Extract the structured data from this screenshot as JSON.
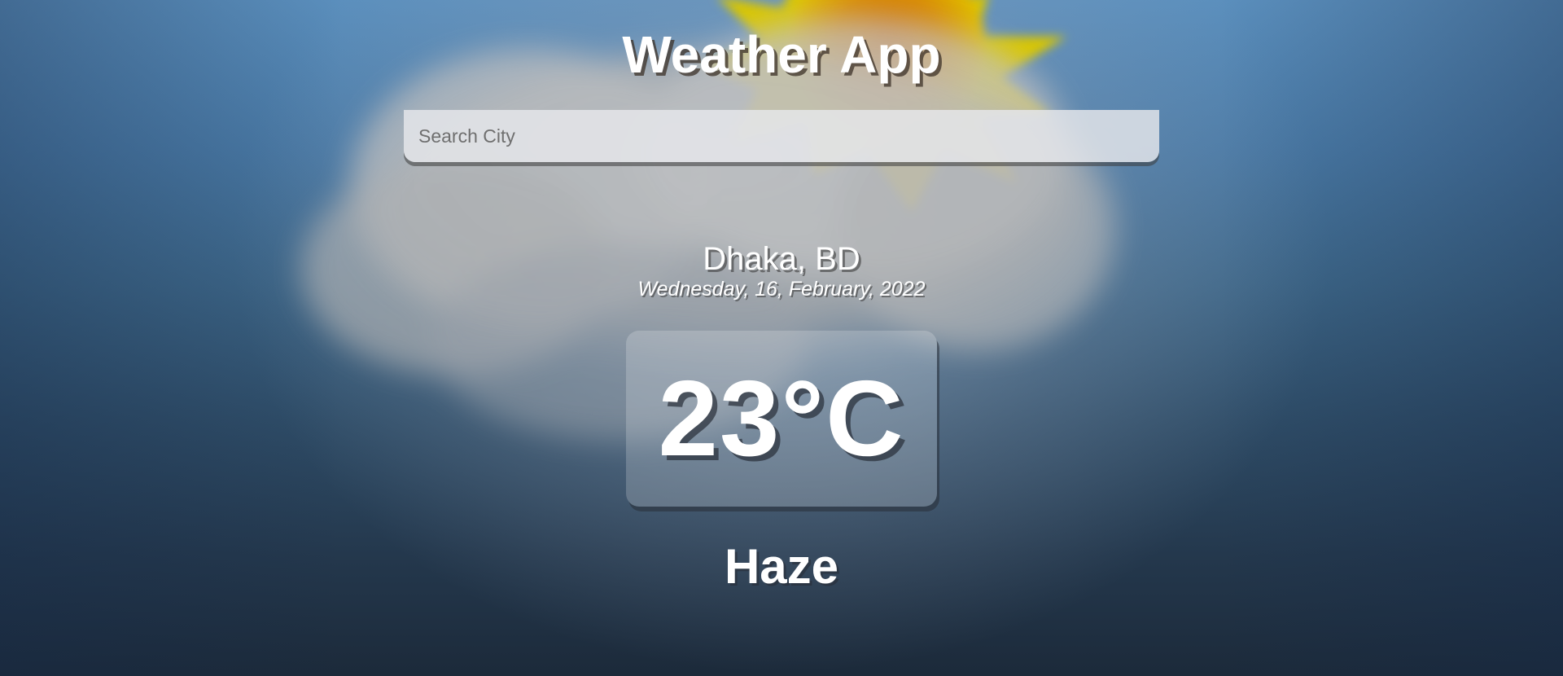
{
  "app": {
    "title": "Weather App"
  },
  "search": {
    "placeholder": "Search City",
    "value": ""
  },
  "weather": {
    "location": "Dhaka, BD",
    "date": "Wednesday, 16, February, 2022",
    "temperature": "23°C",
    "condition": "Haze"
  },
  "background": {
    "icon": "sun-behind-cloud-icon",
    "sky_top_color": "#5b8fbd",
    "sky_bottom_color": "#1c2a3a",
    "sun_color": "#e0c800",
    "cloud_color": "#c8c8c8"
  }
}
